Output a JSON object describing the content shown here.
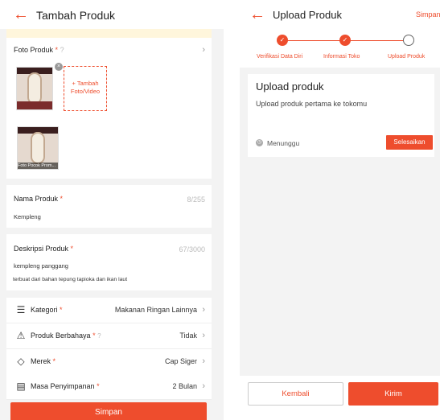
{
  "left": {
    "header": {
      "back_icon": "arrow-left-icon",
      "title": "Tambah Produk"
    },
    "photo": {
      "label": "Foto Produk",
      "required_mark": "*",
      "help_icon": "?",
      "add_button_label": "+ Tambah Foto/Video",
      "cover_caption": "Foto Pocok Prom..."
    },
    "name_field": {
      "label": "Nama Produk",
      "required_mark": "*",
      "counter": "8/255",
      "value": "Kempleng"
    },
    "description_field": {
      "label": "Deskripsi Produk",
      "required_mark": "*",
      "counter": "67/3000",
      "line1": "kempleng panggang",
      "line2": "terbuat dari bahan tepung tapioka dan ikan laut"
    },
    "attributes": [
      {
        "icon": "list-icon",
        "glyph": "☰",
        "label": "Kategori",
        "required_mark": "*",
        "has_help": false,
        "value": "Makanan Ringan Lainnya"
      },
      {
        "icon": "warning-icon",
        "glyph": "⚠",
        "label": "Produk Berbahaya",
        "required_mark": "*",
        "has_help": true,
        "value": "Tidak"
      },
      {
        "icon": "diamond-icon",
        "glyph": "◇",
        "label": "Merek",
        "required_mark": "*",
        "has_help": false,
        "value": "Cap Siger"
      },
      {
        "icon": "calendar-icon",
        "glyph": "▤",
        "label": "Masa Penyimpanan",
        "required_mark": "*",
        "has_help": false,
        "value": "2 Bulan"
      }
    ],
    "chevron": "›",
    "save_button": "Simpan"
  },
  "right": {
    "header": {
      "back_icon": "arrow-left-icon",
      "title": "Upload Produk",
      "action": "Simpan"
    },
    "steps": [
      {
        "label": "Verifikasi Data Diri",
        "state": "done"
      },
      {
        "label": "Informasi Toko",
        "state": "done"
      },
      {
        "label": "Upload Produk",
        "state": "current"
      }
    ],
    "card": {
      "title": "Upload produk",
      "subtitle": "Upload produk pertama ke tokomu",
      "status": "Menunggu",
      "finish_button": "Selesaikan"
    },
    "bottom": {
      "back_button": "Kembali",
      "send_button": "Kirim"
    }
  },
  "colors": {
    "accent": "#ee4d2d",
    "background": "#f3f3f3",
    "banner": "#fff6dc"
  }
}
